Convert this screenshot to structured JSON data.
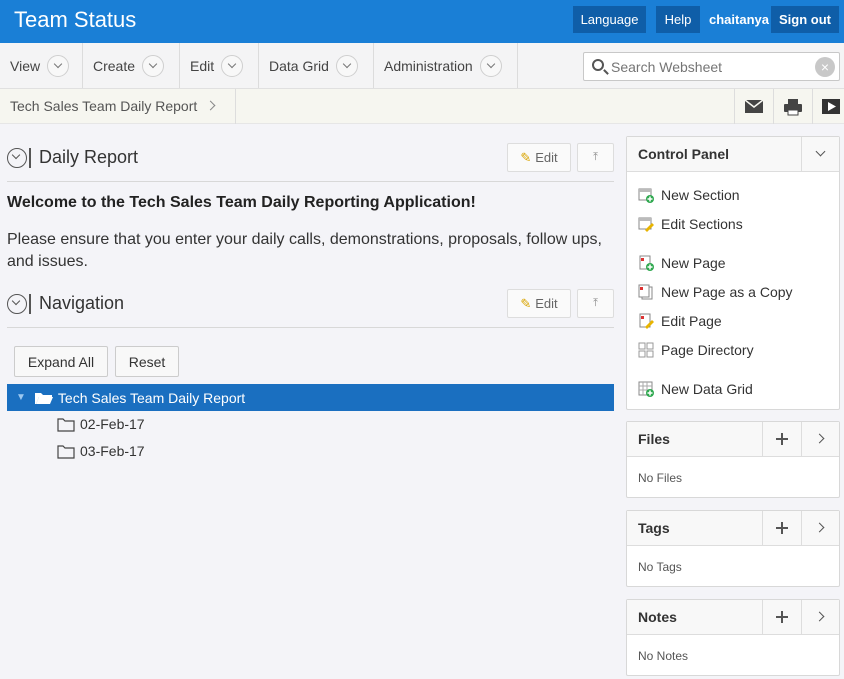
{
  "header": {
    "title": "Team Status",
    "language_label": "Language",
    "help_label": "Help",
    "user": "chaitanya",
    "signout_label": "Sign out"
  },
  "menu": {
    "items": [
      "View",
      "Create",
      "Edit",
      "Data Grid",
      "Administration"
    ]
  },
  "search": {
    "placeholder": "Search Websheet",
    "value": ""
  },
  "breadcrumb": {
    "current": "Tech Sales Team Daily Report"
  },
  "daily_report": {
    "title": "Daily Report",
    "edit_label": "Edit",
    "welcome": "Welcome to the Tech Sales Team Daily Reporting Application!",
    "instructions": "Please ensure that you enter your daily calls, demonstrations, proposals, follow ups, and issues."
  },
  "navigation": {
    "title": "Navigation",
    "edit_label": "Edit",
    "expand_all_label": "Expand All",
    "reset_label": "Reset",
    "tree": {
      "root": "Tech Sales Team Daily Report",
      "children": [
        "02-Feb-17",
        "03-Feb-17"
      ]
    }
  },
  "control_panel": {
    "title": "Control Panel",
    "items": [
      "New Section",
      "Edit Sections",
      "New Page",
      "New Page as a Copy",
      "Edit Page",
      "Page Directory",
      "New Data Grid"
    ]
  },
  "files": {
    "title": "Files",
    "empty": "No Files"
  },
  "tags": {
    "title": "Tags",
    "empty": "No Tags"
  },
  "notes": {
    "title": "Notes",
    "empty": "No Notes"
  },
  "colors": {
    "header": "#1a7fd6",
    "header_button": "#0f5ea8",
    "tree_selected": "#1a6fc0"
  }
}
